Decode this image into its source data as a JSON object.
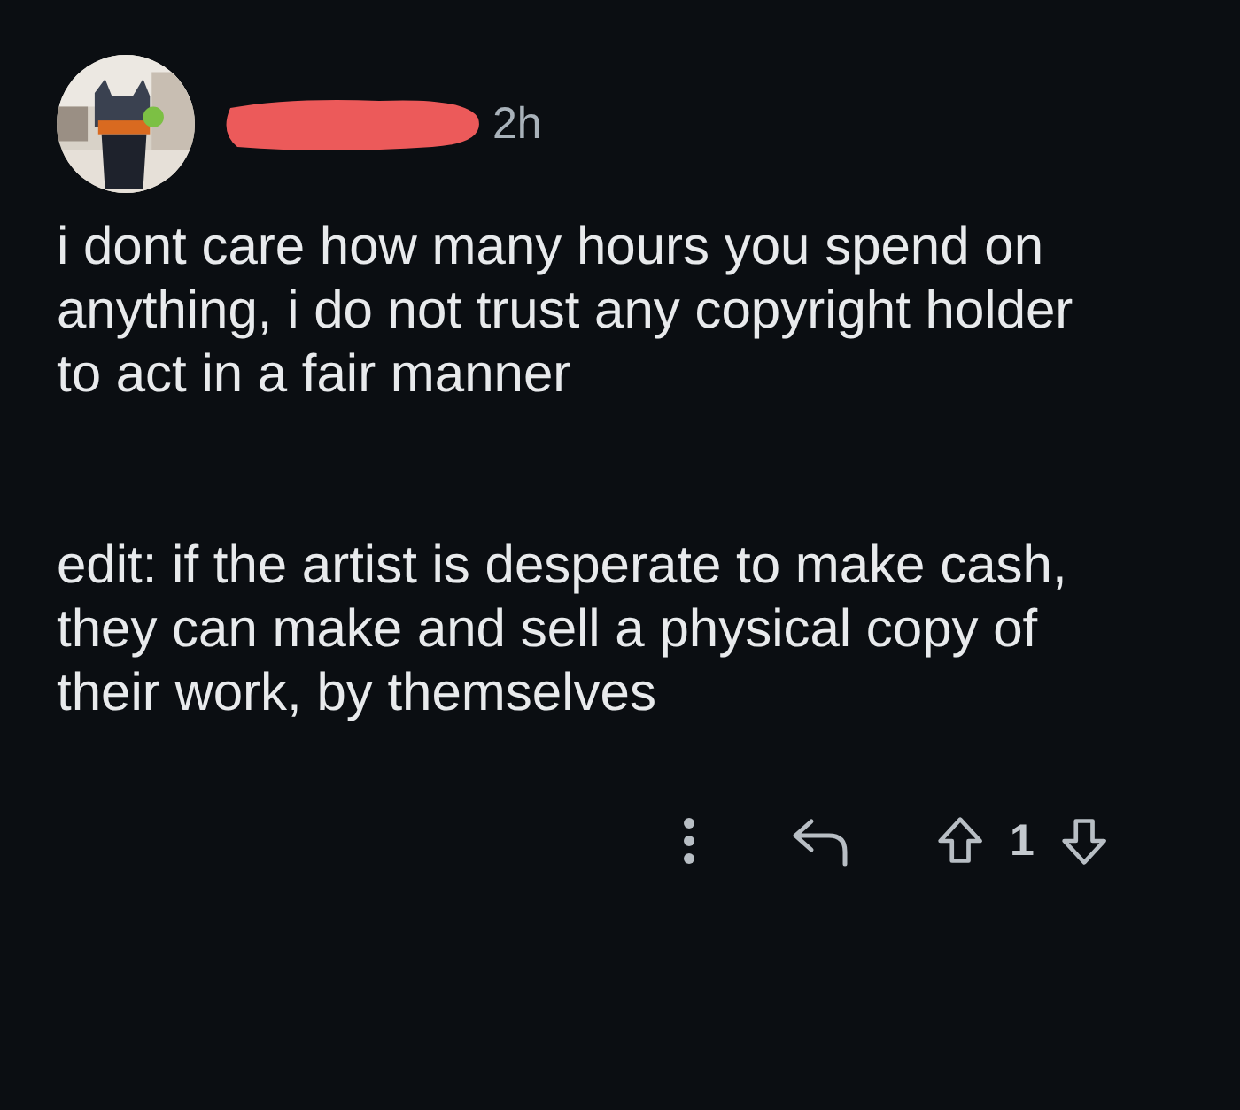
{
  "comment": {
    "time": "2h",
    "paragraphs": [
      "i dont care how many hours you spend on anything, i do not trust any copyright holder to act in a fair manner",
      "edit: if the artist is desperate to make cash, they can make and sell a physical copy of their work, by themselves"
    ],
    "score": "1"
  }
}
